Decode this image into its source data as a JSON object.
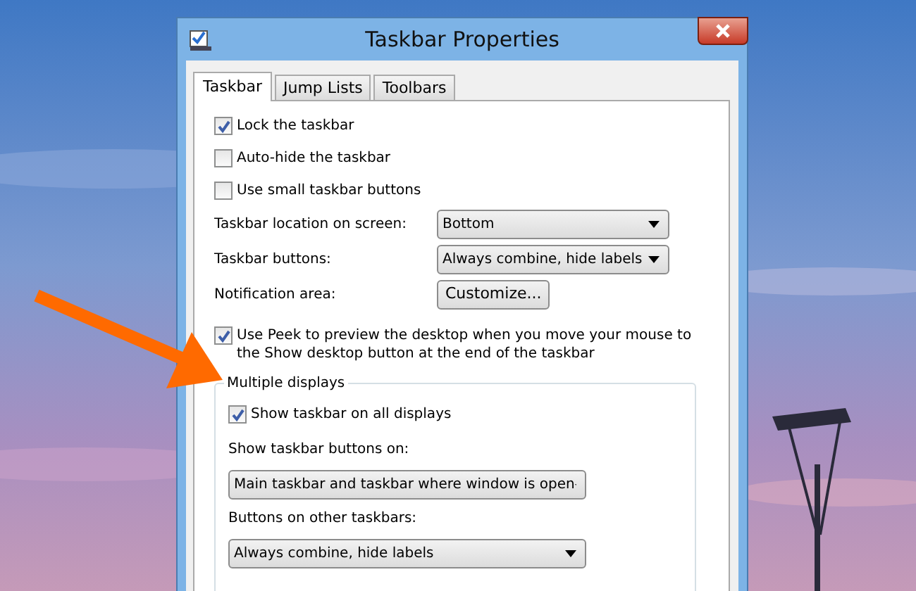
{
  "window": {
    "title": "Taskbar Properties"
  },
  "tabs": [
    {
      "label": "Taskbar",
      "selected": true
    },
    {
      "label": "Jump Lists",
      "selected": false
    },
    {
      "label": "Toolbars",
      "selected": false
    }
  ],
  "options": [
    {
      "label": "Lock the taskbar",
      "checked": true
    },
    {
      "label": "Auto-hide the taskbar",
      "checked": false
    },
    {
      "label": "Use small taskbar buttons",
      "checked": false
    }
  ],
  "settings": [
    {
      "label": "Taskbar location on screen:",
      "kind": "dropdown",
      "value": "Bottom"
    },
    {
      "label": "Taskbar buttons:",
      "kind": "dropdown",
      "value": "Always combine, hide labels"
    },
    {
      "label": "Notification area:",
      "kind": "button",
      "value": "Customize..."
    }
  ],
  "peek": {
    "label": "Use Peek to preview the desktop when you move your mouse to the Show desktop button at the end of the taskbar",
    "checked": true
  },
  "multiple_displays": {
    "title": "Multiple displays",
    "show_on_all": {
      "label": "Show taskbar on all displays",
      "checked": true
    },
    "fields": [
      {
        "label": "Show taskbar buttons on:",
        "value": "Main taskbar and taskbar where window is open"
      },
      {
        "label": "Buttons on other taskbars:",
        "value": "Always combine, hide labels"
      }
    ]
  }
}
